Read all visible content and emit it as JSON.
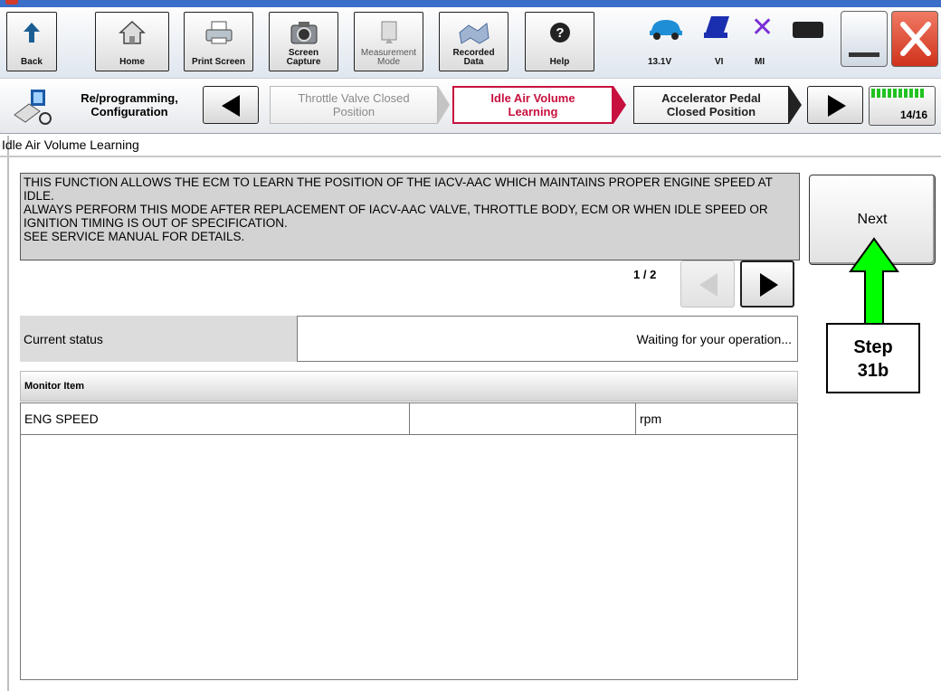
{
  "toolbar": {
    "back_label": "Back",
    "home_label": "Home",
    "print_label": "Print Screen",
    "capture_label": "Screen\nCapture",
    "measurement_label": "Measurement\nMode",
    "recorded_label": "Recorded\nData",
    "help_label": "Help",
    "voltage": "13.1V",
    "vi_label": "VI",
    "mi_label": "MI"
  },
  "breadcrumb": {
    "section_label": "Re/programming,\nConfiguration",
    "prev_step": "Throttle Valve Closed\nPosition",
    "current_step": "Idle Air Volume\nLearning",
    "next_step": "Accelerator Pedal\nClosed Position",
    "progress": "14/16",
    "progress_value": 0.875
  },
  "page": {
    "title": "Idle Air Volume Learning",
    "message": "THIS FUNCTION ALLOWS THE ECM TO LEARN THE POSITION OF THE IACV-AAC WHICH MAINTAINS PROPER ENGINE SPEED AT IDLE.\nALWAYS PERFORM THIS MODE AFTER REPLACEMENT OF IACV-AAC VALVE, THROTTLE BODY, ECM OR WHEN IDLE SPEED OR IGNITION TIMING IS OUT OF SPECIFICATION.\nSEE SERVICE MANUAL FOR DETAILS.",
    "pager": "1 / 2",
    "next_label": "Next",
    "status_label": "Current status",
    "status_value": "Waiting for your operation...",
    "monitor_header": "Monitor Item",
    "monitor_rows": [
      {
        "item": "ENG SPEED",
        "value": "",
        "unit": "rpm"
      }
    ]
  },
  "annotation": {
    "step_label": "Step\n31b",
    "arrow_color": "#00ff00"
  },
  "colors": {
    "current_step_border": "#c8103e",
    "current_step_text": "#c8103e",
    "close_button": "#d94025",
    "progress_green": "#22c322"
  }
}
